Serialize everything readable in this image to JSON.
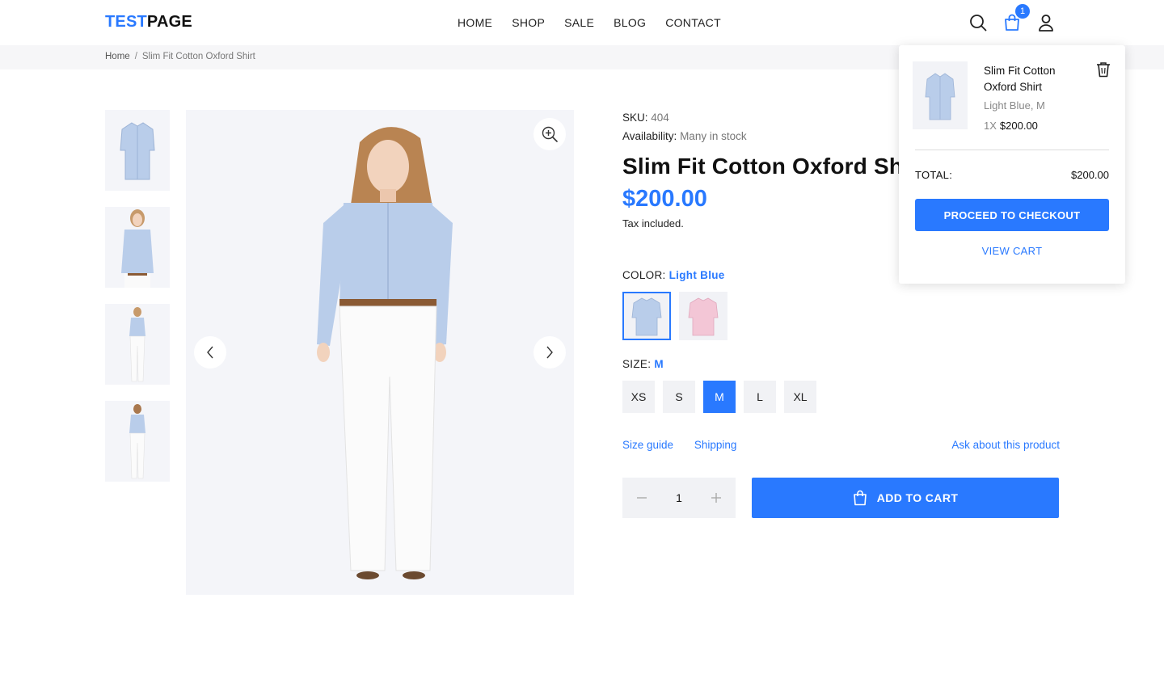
{
  "header": {
    "logo_accent": "TEST",
    "logo_rest": "PAGE",
    "nav": [
      "HOME",
      "SHOP",
      "SALE",
      "BLOG",
      "CONTACT"
    ],
    "cart_count": "1",
    "icons": [
      "search-icon",
      "cart-icon",
      "user-icon"
    ]
  },
  "breadcrumb": {
    "home": "Home",
    "separator": "/",
    "current": "Slim Fit Cotton Oxford Shirt"
  },
  "gallery": {
    "thumbnails": [
      "shirt-front",
      "model-front-closeup",
      "model-full-front",
      "model-full-back"
    ],
    "icons": [
      "zoom-in-icon",
      "chevron-left-icon",
      "chevron-right-icon"
    ]
  },
  "product": {
    "sku_label": "SKU:",
    "sku_value": "404",
    "availability_label": "Availability:",
    "availability_value": "Many in stock",
    "title": "Slim Fit Cotton Oxford Shirt",
    "price": "$200.00",
    "tax_note": "Tax included.",
    "color_label": "COLOR:",
    "color_selected": "Light Blue",
    "colors": [
      {
        "name": "Light Blue",
        "hex": "#b9cdea"
      },
      {
        "name": "Pink",
        "hex": "#f3c6d6"
      }
    ],
    "size_label": "SIZE:",
    "size_selected": "M",
    "sizes": [
      "XS",
      "S",
      "M",
      "L",
      "XL"
    ],
    "links": {
      "size_guide": "Size guide",
      "shipping": "Shipping",
      "ask": "Ask about this product"
    },
    "quantity": "1",
    "add_to_cart": "ADD TO CART"
  },
  "minicart": {
    "item_name": "Slim Fit Cotton Oxford Shirt",
    "item_variant": "Light Blue, M",
    "item_qty": "1X",
    "item_price": "$200.00",
    "total_label": "TOTAL:",
    "total_value": "$200.00",
    "checkout": "PROCEED TO CHECKOUT",
    "view_cart": "VIEW CART"
  },
  "colors": {
    "accent": "#2979ff",
    "surface": "#f4f5f9",
    "text": "#1a1a1a"
  }
}
